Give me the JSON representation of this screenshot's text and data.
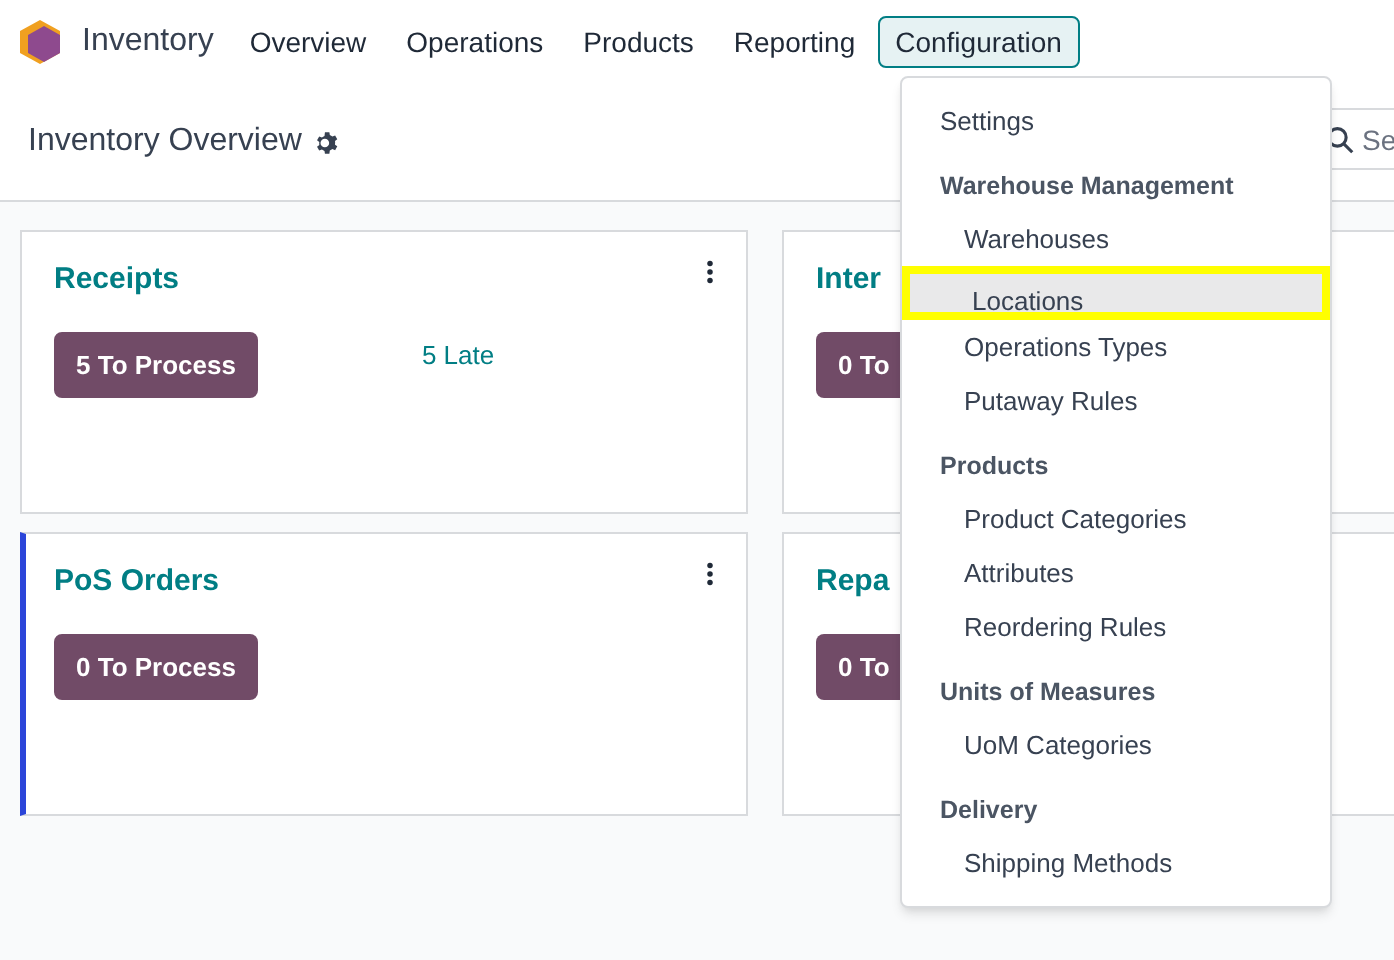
{
  "app": {
    "name": "Inventory"
  },
  "nav": [
    {
      "label": "Overview",
      "selected": false
    },
    {
      "label": "Operations",
      "selected": false
    },
    {
      "label": "Products",
      "selected": false
    },
    {
      "label": "Reporting",
      "selected": false
    },
    {
      "label": "Configuration",
      "selected": true
    }
  ],
  "page_title": "Inventory Overview",
  "search": {
    "placeholder": "Se"
  },
  "cards": [
    {
      "title": "Receipts",
      "button": "5 To Process",
      "late": "5 Late"
    },
    {
      "title": "Inter",
      "button": "0 To"
    },
    {
      "title": "PoS Orders",
      "button": "0 To Process",
      "color": "#2b45d9"
    },
    {
      "title": "Repa",
      "button": "0 To"
    }
  ],
  "dropdown": [
    {
      "kind": "item",
      "label": "Settings",
      "selected": false
    },
    {
      "kind": "header",
      "label": "Warehouse Management"
    },
    {
      "kind": "subitem",
      "label": "Warehouses",
      "selected": false
    },
    {
      "kind": "subitem",
      "label": "Locations",
      "selected": true
    },
    {
      "kind": "subitem",
      "label": "Operations Types",
      "selected": false
    },
    {
      "kind": "subitem",
      "label": "Putaway Rules",
      "selected": false
    },
    {
      "kind": "header",
      "label": "Products"
    },
    {
      "kind": "subitem",
      "label": "Product Categories",
      "selected": false
    },
    {
      "kind": "subitem",
      "label": "Attributes",
      "selected": false
    },
    {
      "kind": "subitem",
      "label": "Reordering Rules",
      "selected": false
    },
    {
      "kind": "header",
      "label": "Units of Measures"
    },
    {
      "kind": "subitem",
      "label": "UoM Categories",
      "selected": false
    },
    {
      "kind": "header",
      "label": "Delivery"
    },
    {
      "kind": "subitem",
      "label": "Shipping Methods",
      "selected": false
    }
  ]
}
